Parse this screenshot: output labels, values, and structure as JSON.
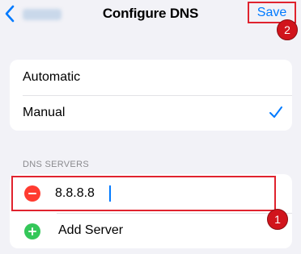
{
  "nav": {
    "title": "Configure DNS",
    "save_label": "Save"
  },
  "annotations": {
    "step_1": "1",
    "step_2": "2"
  },
  "mode": {
    "options": [
      {
        "label": "Automatic",
        "selected": false
      },
      {
        "label": "Manual",
        "selected": true
      }
    ]
  },
  "dns": {
    "section_header": "DNS SERVERS",
    "servers": [
      {
        "value": "8.8.8.8"
      }
    ],
    "add_label": "Add Server"
  },
  "colors": {
    "accent": "#007aff",
    "remove": "#ff3b30",
    "add": "#34c759",
    "annotation": "#e0232e"
  }
}
